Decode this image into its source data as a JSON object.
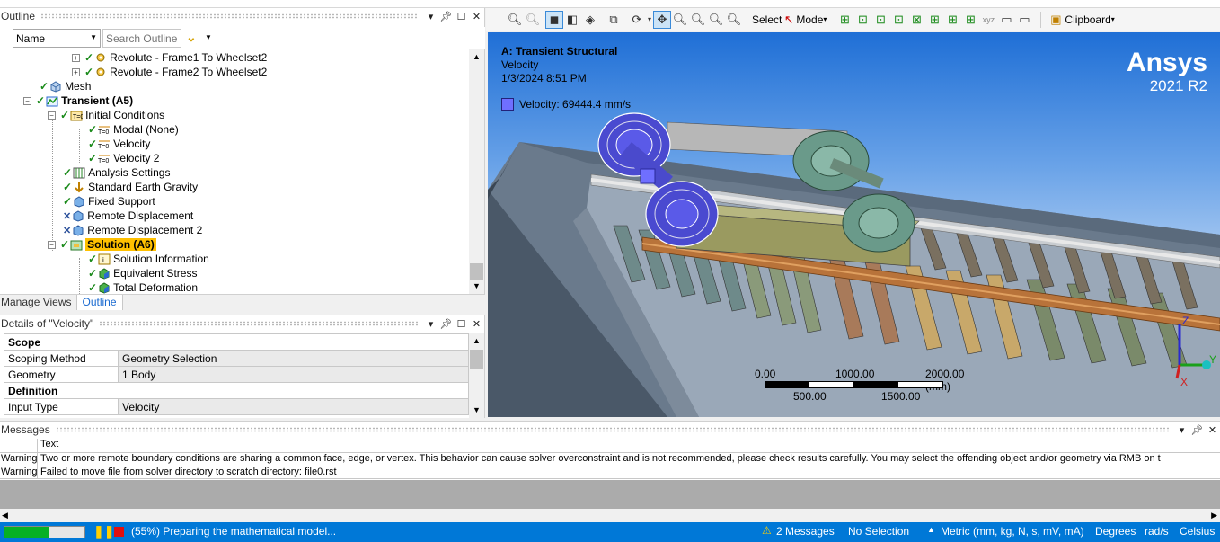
{
  "outline": {
    "title": "Outline",
    "filter_select": "Name",
    "search_placeholder": "Search Outline",
    "tree": [
      {
        "label": "Revolute - Frame1 To Wheelset2",
        "icon": "joint-icon"
      },
      {
        "label": "Revolute - Frame2 To Wheelset2",
        "icon": "joint-icon"
      },
      {
        "label": "Mesh",
        "icon": "mesh-icon"
      },
      {
        "label": "Transient (A5)",
        "icon": "transient-icon"
      },
      {
        "label": "Initial Conditions",
        "icon": "initial-conditions-icon"
      },
      {
        "label": "Modal (None)",
        "icon": "t0-icon"
      },
      {
        "label": "Velocity",
        "icon": "t0-icon"
      },
      {
        "label": "Velocity 2",
        "icon": "t0-icon"
      },
      {
        "label": "Analysis Settings",
        "icon": "analysis-settings-icon"
      },
      {
        "label": "Standard Earth Gravity",
        "icon": "gravity-icon"
      },
      {
        "label": "Fixed Support",
        "icon": "fixed-support-icon"
      },
      {
        "label": "Remote Displacement",
        "icon": "remote-displacement-icon"
      },
      {
        "label": "Remote Displacement 2",
        "icon": "remote-displacement-icon"
      },
      {
        "label": "Solution (A6)",
        "icon": "solution-icon"
      },
      {
        "label": "Solution Information",
        "icon": "solution-information-icon"
      },
      {
        "label": "Equivalent Stress",
        "icon": "result-icon"
      },
      {
        "label": "Total Deformation",
        "icon": "result-icon"
      }
    ],
    "tabs": [
      "Manage Views",
      "Outline"
    ]
  },
  "details": {
    "title": "Details of \"Velocity\"",
    "rows": [
      {
        "type": "section",
        "label": "Scope"
      },
      {
        "type": "prop",
        "label": "Scoping Method",
        "value": "Geometry Selection"
      },
      {
        "type": "prop",
        "label": "Geometry",
        "value": "1 Body"
      },
      {
        "type": "section",
        "label": "Definition"
      },
      {
        "type": "prop",
        "label": "Input Type",
        "value": "Velocity"
      }
    ]
  },
  "toolbar": {
    "select_label": "Select",
    "mode_label": "Mode",
    "clipboard_label": "Clipboard"
  },
  "viewport": {
    "analysis_title": "A: Transient Structural",
    "result_name": "Velocity",
    "timestamp": "1/3/2024 8:51 PM",
    "legend_label": "Velocity: 69444.4 mm/s",
    "legend_color": "#6f6fff",
    "brand": "Ansys",
    "version": "2021 R2",
    "scale_top": [
      "0.00",
      "1000.00",
      "2000.00 (mm)"
    ],
    "scale_bottom": [
      "500.00",
      "1500.00"
    ],
    "axes": {
      "x": "X",
      "y": "Y",
      "z": "Z"
    }
  },
  "messages": {
    "title": "Messages",
    "column_header": "Text",
    "rows": [
      {
        "type": "Warning",
        "text": "Two or more remote boundary conditions are sharing a common face, edge, or vertex.  This behavior can cause solver overconstraint and is not recommended, please check results carefully.  You may select the offending object and/or geometry via RMB on t"
      },
      {
        "type": "Warning",
        "text": "Failed to move file from solver directory to scratch directory: file0.rst"
      }
    ]
  },
  "status": {
    "progress": 0.55,
    "progress_text": "(55%) Preparing the mathematical model...",
    "messages": "2 Messages",
    "selection": "No Selection",
    "units": "Metric (mm, kg, N, s, mV, mA)",
    "angle": "Degrees",
    "rate": "rad/s",
    "temp": "Celsius"
  },
  "colors": {
    "accent": "#0078d7",
    "highlight": "#ffc000",
    "viewport_top": "#1f6fd6",
    "viewport_bottom": "#ffffff"
  }
}
